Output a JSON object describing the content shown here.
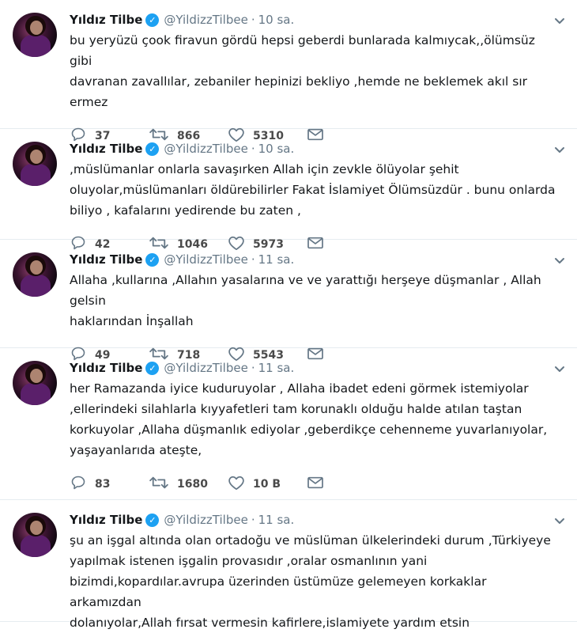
{
  "tweets": [
    {
      "name": "Yıldız Tilbe",
      "handle": "@YildizzTilbee",
      "time": "10 sa.",
      "text": "bu yeryüzü çook firavun gördü hepsi geberdi bunlarada kalmıycak,,ölümsüz gibi\ndavranan zavallılar, zebaniler hepinizi bekliyo ,hemde ne beklemek  akıl sır ermez",
      "replies": "37",
      "retweets": "866",
      "likes": "5310"
    },
    {
      "name": "Yıldız Tilbe",
      "handle": "@YildizzTilbee",
      "time": "10 sa.",
      "text": ",müslümanlar onlarla savaşırken  Allah için zevkle ölüyolar şehit\noluyolar,müslümanları öldürebilirler Fakat İslamiyet Ölümsüzdür . bunu onlarda\nbiliyo , kafalarını yedirende bu zaten ,",
      "replies": "42",
      "retweets": "1046",
      "likes": "5973"
    },
    {
      "name": "Yıldız Tilbe",
      "handle": "@YildizzTilbee",
      "time": "11 sa.",
      "text": "Allaha ,kullarına ,Allahın yasalarına ve  ve yarattığı herşeye düşmanlar , Allah gelsin\nhaklarından İnşallah",
      "replies": "49",
      "retweets": "718",
      "likes": "5543"
    },
    {
      "name": "Yıldız Tilbe",
      "handle": "@YildizzTilbee",
      "time": "11 sa.",
      "text": "her Ramazanda iyice kuduruyolar , Allaha ibadet edeni görmek istemiyolar\n,ellerindeki silahlarla kıyyafetleri tam korunaklı olduğu halde atılan taştan\nkorkuyolar ,Allaha düşmanlık ediyolar ,geberdikçe cehenneme yuvarlanıyolar,\nyaşayanlarıda ateşte,",
      "replies": "83",
      "retweets": "1680",
      "likes": "10 B"
    },
    {
      "name": "Yıldız Tilbe",
      "handle": "@YildizzTilbee",
      "time": "11 sa.",
      "text": "şu an işgal altında olan ortadoğu ve müslüman ülkelerindeki durum ,Türkiyeye\nyapılmak istenen işgalin provasıdır ,oralar osmanlının yani\nbizimdi,kopardılar.avrupa üzerinden üstümüze gelemeyen korkaklar arkamızdan\ndolanıyolar,Allah fırsat vermesin kafirlere,islamiyete yardım etsin",
      "replies": "",
      "retweets": "",
      "likes": ""
    }
  ],
  "ui": {
    "dot": "·",
    "verified_check": "✓",
    "icons": [
      "reply-icon",
      "retweet-icon",
      "like-icon",
      "direct-message-icon",
      "chevron-down-icon",
      "verified-badge-icon"
    ],
    "colors": {
      "verified": "#1da1f2",
      "muted": "#657786",
      "divider": "#e6ecf0"
    }
  }
}
